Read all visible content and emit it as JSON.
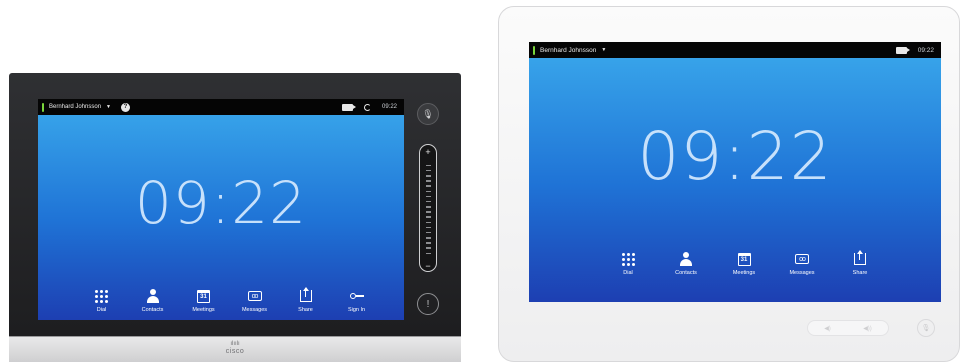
{
  "left_device": {
    "status_bar": {
      "user": "Bernhard Johnsson",
      "caret": "▼",
      "help": "?",
      "time": "09:22"
    },
    "clock": "09:22",
    "dock": [
      {
        "label": "Dial",
        "icon": "dial-pad-icon"
      },
      {
        "label": "Contacts",
        "icon": "contacts-icon"
      },
      {
        "label": "Meetings",
        "icon": "calendar-icon",
        "glyph": "31"
      },
      {
        "label": "Messages",
        "icon": "voicemail-icon",
        "glyph": "oo"
      },
      {
        "label": "Share",
        "icon": "share-icon"
      },
      {
        "label": "Sign In",
        "icon": "key-icon"
      }
    ],
    "side_controls": {
      "volume_plus": "+",
      "volume_minus": "−",
      "alert": "!"
    },
    "brand": {
      "bars": "ılıılı",
      "name": "cisco"
    }
  },
  "right_device": {
    "status_bar": {
      "user": "Bernhard Johnsson",
      "caret": "▼",
      "time": "09:22"
    },
    "clock": "09:22",
    "dock": [
      {
        "label": "Dial",
        "icon": "dial-pad-icon"
      },
      {
        "label": "Contacts",
        "icon": "contacts-icon"
      },
      {
        "label": "Meetings",
        "icon": "calendar-icon",
        "glyph": "31"
      },
      {
        "label": "Messages",
        "icon": "voicemail-icon",
        "glyph": "oo"
      },
      {
        "label": "Share",
        "icon": "share-icon"
      }
    ]
  }
}
